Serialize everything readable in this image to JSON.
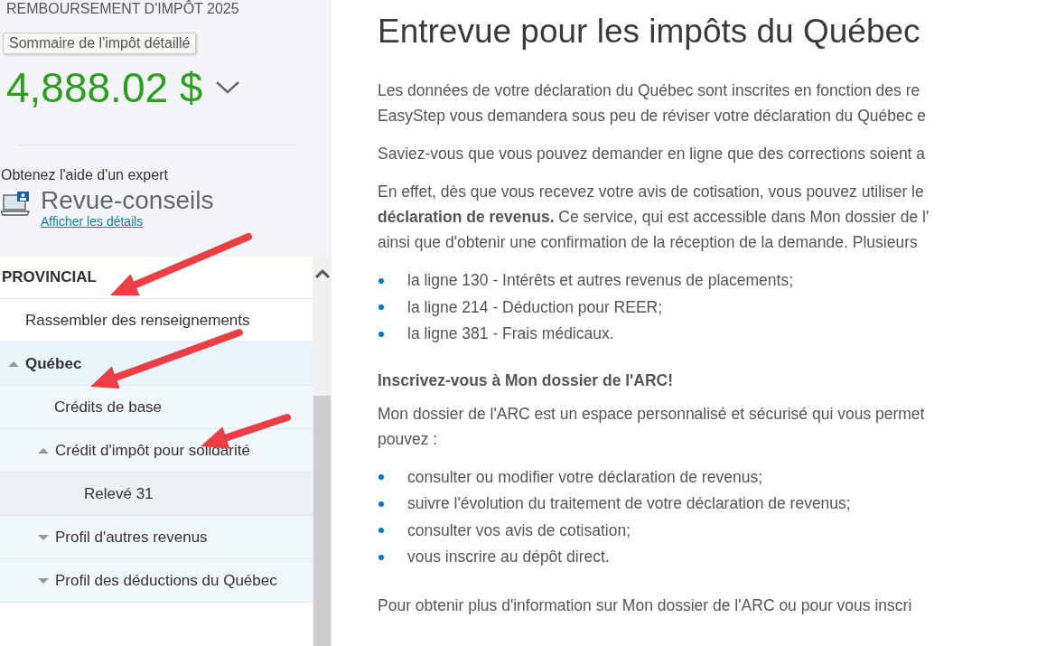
{
  "sidebar": {
    "refund_label": "REMBOURSEMENT D'IMPÔT 2025",
    "refund_amount": "4,888.02 $",
    "tooltip": "Sommaire de l'impôt détaillé",
    "expert_prompt": "Obtenez l'aide d'un expert",
    "expert_service": "Revue-conseils",
    "details_link": "Afficher les détails"
  },
  "nav": {
    "section": "PROVINCIAL",
    "items": [
      {
        "label": "Rassembler des renseignements",
        "selected": false
      },
      {
        "label": "Québec",
        "selected": true,
        "expanded": true,
        "children": [
          {
            "label": "Crédits de base",
            "selected": false
          },
          {
            "label": "Crédit d'impôt pour solidarité",
            "selected": false,
            "expanded": true,
            "children": [
              {
                "label": "Relevé 31",
                "selected": false
              }
            ]
          },
          {
            "label": "Profil d'autres revenus",
            "selected": false,
            "expanded": false
          },
          {
            "label": "Profil des déductions du Québec",
            "selected": false,
            "expanded": false
          }
        ]
      }
    ]
  },
  "content": {
    "title": "Entrevue pour les impôts du Québec",
    "blocks": [
      {
        "kind": "paragraph",
        "lines": [
          "Les données de votre déclaration du Québec sont inscrites en fonction des re",
          "EasyStep vous demandera sous peu de réviser votre déclaration du Québec e"
        ]
      },
      {
        "kind": "paragraph",
        "lines": [
          "Saviez-vous que vous pouvez demander en ligne que des corrections soient a"
        ]
      },
      {
        "kind": "paragraph",
        "lines": [
          "En effet, dès que vous recevez votre avis de cotisation, vous pouvez utiliser le",
          "**déclaration de revenus.** Ce service, qui est accessible dans Mon dossier de l'",
          "ainsi que d'obtenir une confirmation de la réception de la demande. Plusieurs"
        ]
      },
      {
        "kind": "bullets",
        "items": [
          "la ligne 130 - Intérêts et autres revenus de placements;",
          "la ligne 214 - Déduction pour REER;",
          "la ligne 381 - Frais médicaux."
        ]
      },
      {
        "kind": "heading",
        "lines": [
          "Inscrivez-vous à Mon dossier de l'ARC!"
        ]
      },
      {
        "kind": "paragraph",
        "lines": [
          "Mon dossier de l'ARC est un espace personnalisé et sécurisé qui vous permet",
          "pouvez :"
        ]
      },
      {
        "kind": "bullets",
        "items": [
          "consulter ou modifier votre déclaration de revenus;",
          "suivre l'évolution du traitement de votre déclaration de revenus;",
          "consulter vos avis de cotisation;",
          "vous inscrire au dépôt direct."
        ]
      },
      {
        "kind": "paragraph",
        "lines": [
          "Pour obtenir plus d'information sur Mon dossier de l'ARC ou pour vous inscri"
        ]
      }
    ]
  },
  "annotations": [
    {
      "kind": "arrow"
    },
    {
      "kind": "arrow"
    },
    {
      "kind": "arrow"
    }
  ]
}
